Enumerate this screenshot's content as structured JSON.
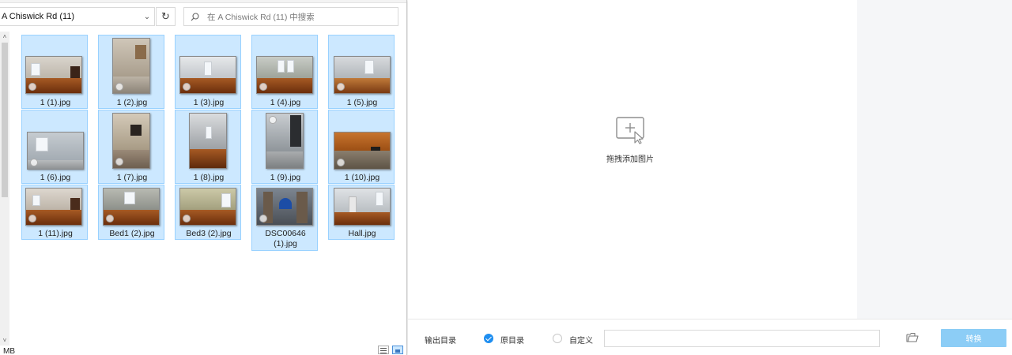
{
  "explorer": {
    "address_path": "A Chiswick Rd (11)",
    "search_placeholder": "在 A Chiswick Rd (11) 中搜索",
    "status_text": "MB",
    "files": [
      {
        "name": "1 (1).jpg",
        "selected": true
      },
      {
        "name": "1 (2).jpg",
        "selected": true
      },
      {
        "name": "1 (3).jpg",
        "selected": true
      },
      {
        "name": "1 (4).jpg",
        "selected": true
      },
      {
        "name": "1 (5).jpg",
        "selected": true
      },
      {
        "name": "1 (6).jpg",
        "selected": true
      },
      {
        "name": "1 (7).jpg",
        "selected": true
      },
      {
        "name": "1 (8).jpg",
        "selected": true
      },
      {
        "name": "1 (9).jpg",
        "selected": true
      },
      {
        "name": "1 (10).jpg",
        "selected": true
      },
      {
        "name": "1 (11).jpg",
        "selected": true
      },
      {
        "name": "Bed1 (2).jpg",
        "selected": true
      },
      {
        "name": "Bed3 (2).jpg",
        "selected": true
      },
      {
        "name": "DSC00646 (1).jpg",
        "selected": true
      },
      {
        "name": "Hall.jpg",
        "selected": true
      }
    ]
  },
  "converter": {
    "drop_text": "拖拽添加图片",
    "output_dir_label": "输出目录",
    "option_original": "原目录",
    "option_custom": "自定义",
    "custom_path_value": "",
    "convert_label": "转换",
    "selected_option": "原目录",
    "accent_color": "#1e8ef0",
    "button_color": "#8ccdf6"
  },
  "icons": [
    "chevron-down-icon",
    "refresh-icon",
    "search-icon",
    "scroll-up-icon",
    "scroll-down-icon",
    "details-view-icon",
    "thumbnail-view-icon",
    "add-image-icon",
    "folder-icon",
    "check-icon"
  ]
}
